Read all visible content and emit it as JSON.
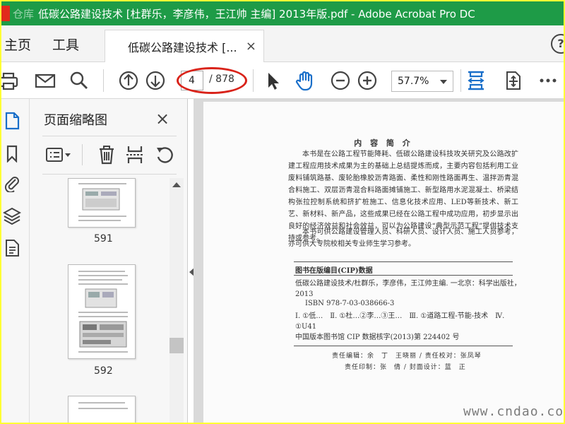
{
  "window": {
    "title": "低碳公路建设技术 [杜群乐，李彦伟，王江帅 主编] 2013年版.pdf - Adobe Acrobat Pro DC",
    "watermark": "仓库"
  },
  "menu": {
    "home": "主页",
    "tools": "工具",
    "tab_label": "低碳公路建设技术 [...",
    "tab_close": "×",
    "help": "?"
  },
  "toolbar": {
    "current_page": "4",
    "total_pages": "/ 878",
    "zoom": "57.7%"
  },
  "thumbnails": {
    "title": "页面缩略图",
    "close": "×",
    "pages": [
      {
        "label": "591"
      },
      {
        "label": "592"
      }
    ]
  },
  "document": {
    "heading": "内 容 简 介",
    "summary_paragraphs": [
      "本书是在公路工程节能降耗、低碳公路建设科技攻关研究及公路改扩建工程应用技术成果为主的基础上总结提炼而成，主要内容包括利用工业废料铺筑路基、废轮胎橡胶沥青路面、柔性和刚性路面再生、温拌沥青混合料施工、双层沥青混合料路面摊铺施工、新型路用水泥混凝土、桥梁结构张拉控制系统和挤扩桩施工、信息化技术应用、LED等新技术、新工艺、新材料、新产品，这些成果已经在公路工程中成功应用，初步显示出良好的经济效益和社会效益，可以为公路建设“典型示范工程”提供技术支持或参考。",
      "本书可供公路建设管理人员、科研人员、设计人员、施工人员参考，亦可供大专院校相关专业师生学习参考。"
    ],
    "cip_title": "图书在版编目(CIP)数据",
    "cip_lines": [
      "低碳公路建设技术/杜群乐，李彦伟，王江帅主编. 一北京：科学出版社，2013",
      "ISBN 978-7-03-038666-3",
      "Ⅰ. ①低…　Ⅱ. ①杜…②李…③王…　Ⅲ. ①道路工程-节能-技术　Ⅳ. ①U41",
      "中国版本图书馆 CIP 数据核字(2013)第 224402 号"
    ],
    "credits": [
      "责任编辑：余　丁　王晓丽 / 责任校对：张凤琴",
      "责任印制：张　倩 / 封面设计：蓝　正"
    ],
    "site_watermark": "www.cndao.com"
  },
  "colors": {
    "titlebar": "#1e9b47",
    "accent_blue": "#1a6fc9",
    "highlight_ellipse": "#d9231a",
    "outer_border": "#ffff33"
  }
}
